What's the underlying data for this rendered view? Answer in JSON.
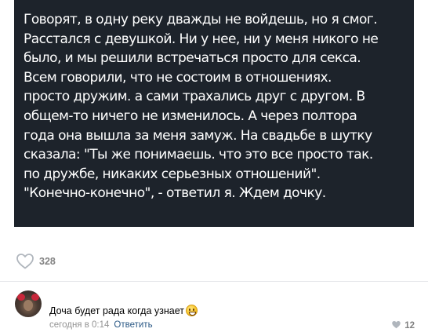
{
  "post": {
    "text_lines": [
      "Говорят, в одну реку дважды не войдешь, но я смог.",
      "Расстался с девушкой. Ни у нее, ни у меня никого не",
      "было, и мы решили встречаться просто для секса.",
      "Всем говорили, что не состоим в отношениях.",
      "просто дружим. а сами трахались друг с другом. В",
      "общем-то ничего не изменилось. А через полтора",
      "года она вышла за меня замуж. На свадьбе в шутку",
      "сказала: \"Ты же понимаешь. что это все просто так.",
      "по дружбе, никаких серьезных отношений\".",
      "\"Конечно-конечно\", - ответил я. Ждем дочку."
    ],
    "likes_count": "328",
    "like_icon": "heart-outline-icon"
  },
  "comment": {
    "text": "Доча будет рада когда узнает",
    "emoji": "grinning-emoji",
    "timestamp": "сегодня в 0:14",
    "reply_label": "Ответить",
    "likes_count": "12",
    "like_icon": "heart-filled-icon"
  },
  "colors": {
    "image_background": "#1d232b",
    "link": "#2a5885",
    "muted": "#939393",
    "icon_gray": "#b0b6bd"
  }
}
